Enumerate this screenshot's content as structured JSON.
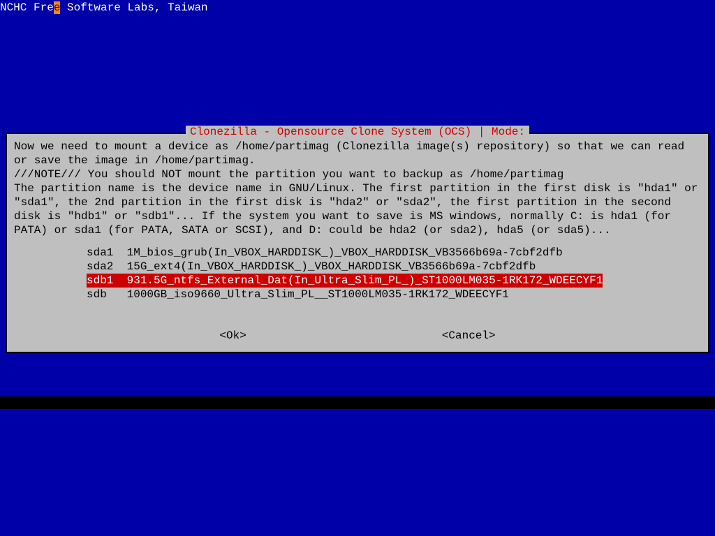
{
  "header": {
    "prefix": "NCHC Fre",
    "cursor_char": "e",
    "suffix": " Software Labs, Taiwan"
  },
  "dialog": {
    "title": "Clonezilla - Opensource Clone System (OCS) | Mode:",
    "body": "Now we need to mount a device as /home/partimag (Clonezilla image(s) repository) so that we can read or save the image in /home/partimag.\n///NOTE/// You should NOT mount the partition you want to backup as /home/partimag\nThe partition name is the device name in GNU/Linux. The first partition in the first disk is \"hda1\" or \"sda1\", the 2nd partition in the first disk is \"hda2\" or \"sda2\", the first partition in the second disk is \"hdb1\" or \"sdb1\"... If the system you want to save is MS windows, normally C: is hda1 (for PATA) or sda1 (for PATA, SATA or SCSI), and D: could be hda2 (or sda2), hda5 (or sda5)..."
  },
  "options": [
    {
      "dev": "sda1",
      "desc": "1M_bios_grub(In_VBOX_HARDDISK_)_VBOX_HARDDISK_VB3566b69a-7cbf2dfb",
      "selected": false
    },
    {
      "dev": "sda2",
      "desc": "15G_ext4(In_VBOX_HARDDISK_)_VBOX_HARDDISK_VB3566b69a-7cbf2dfb",
      "selected": false
    },
    {
      "dev": "sdb1",
      "desc": "931.5G_ntfs_External_Dat(In_Ultra_Slim_PL_)_ST1000LM035-1RK172_WDEECYF1",
      "selected": true
    },
    {
      "dev": "sdb",
      "desc": "1000GB_iso9660_Ultra_Slim_PL__ST1000LM035-1RK172_WDEECYF1",
      "selected": false
    }
  ],
  "buttons": {
    "ok": "<Ok>",
    "cancel": "<Cancel>"
  }
}
